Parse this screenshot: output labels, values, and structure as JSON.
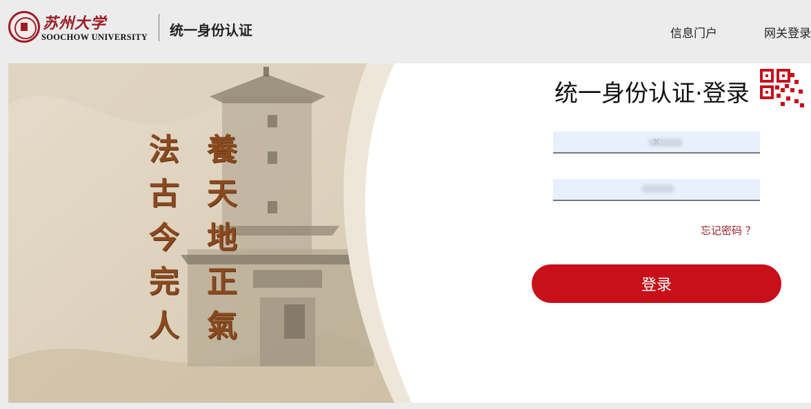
{
  "header": {
    "logo_cn": "苏州大学",
    "logo_en": "SOOCHOW UNIVERSITY",
    "system_title": "统一身份认证",
    "nav": [
      {
        "label": "信息门户"
      },
      {
        "label": "网关登录"
      }
    ]
  },
  "hero": {
    "calligraphy_right": [
      "養",
      "天",
      "地",
      "正",
      "氣"
    ],
    "calligraphy_left": [
      "法",
      "古",
      "今",
      "完",
      "人"
    ]
  },
  "login": {
    "title": "统一身份认证·登录",
    "username_value": "x",
    "password_value": "",
    "forgot_label": "忘记密码 ？",
    "submit_label": "登录"
  },
  "colors": {
    "brand_red": "#c8101a",
    "link_red": "#a21c24",
    "input_bg": "#e8f0fe"
  },
  "icons": {
    "qr": "qr-code-icon",
    "logo": "university-seal-icon"
  }
}
